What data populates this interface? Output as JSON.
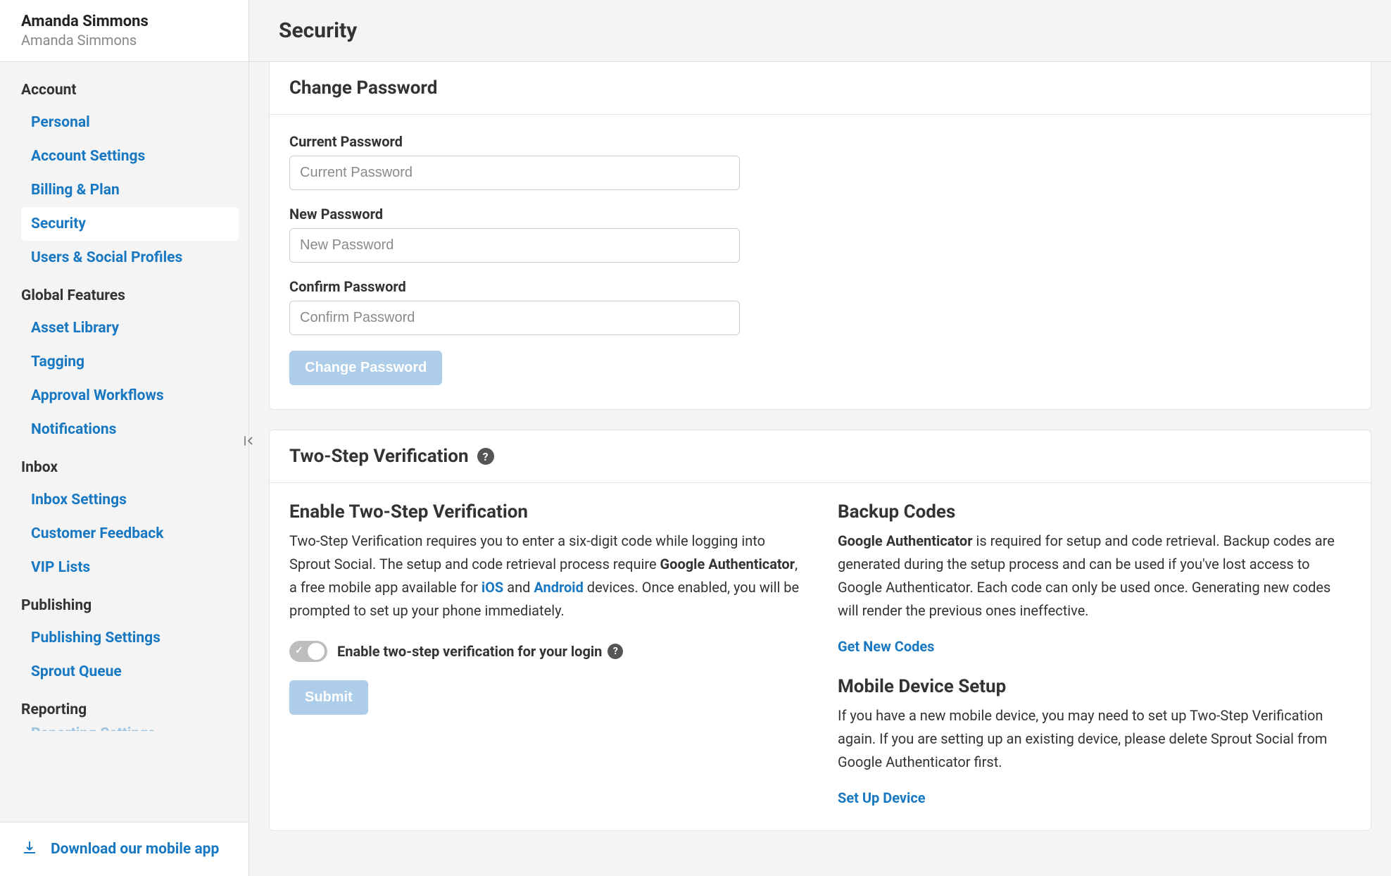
{
  "user": {
    "name": "Amanda Simmons",
    "subname": "Amanda Simmons"
  },
  "sidebar": {
    "sections": [
      {
        "title": "Account",
        "items": [
          {
            "label": "Personal",
            "active": false
          },
          {
            "label": "Account Settings",
            "active": false
          },
          {
            "label": "Billing & Plan",
            "active": false
          },
          {
            "label": "Security",
            "active": true
          },
          {
            "label": "Users & Social Profiles",
            "active": false
          }
        ]
      },
      {
        "title": "Global Features",
        "items": [
          {
            "label": "Asset Library",
            "active": false
          },
          {
            "label": "Tagging",
            "active": false
          },
          {
            "label": "Approval Workflows",
            "active": false
          },
          {
            "label": "Notifications",
            "active": false
          }
        ]
      },
      {
        "title": "Inbox",
        "items": [
          {
            "label": "Inbox Settings",
            "active": false
          },
          {
            "label": "Customer Feedback",
            "active": false
          },
          {
            "label": "VIP Lists",
            "active": false
          }
        ]
      },
      {
        "title": "Publishing",
        "items": [
          {
            "label": "Publishing Settings",
            "active": false
          },
          {
            "label": "Sprout Queue",
            "active": false
          }
        ]
      },
      {
        "title": "Reporting",
        "items": [
          {
            "label": "Reporting Settings",
            "active": false
          }
        ]
      }
    ],
    "footer_label": "Download our mobile app"
  },
  "page": {
    "title": "Security"
  },
  "change_password": {
    "heading": "Change Password",
    "current_label": "Current Password",
    "current_placeholder": "Current Password",
    "new_label": "New Password",
    "new_placeholder": "New Password",
    "confirm_label": "Confirm Password",
    "confirm_placeholder": "Confirm Password",
    "button_label": "Change Password"
  },
  "two_step": {
    "heading": "Two-Step Verification",
    "enable_heading": "Enable Two-Step Verification",
    "enable_desc_1": "Two-Step Verification requires you to enter a six-digit code while logging into Sprout Social. The setup and code retrieval process require ",
    "enable_desc_bold": "Google Authenticator",
    "enable_desc_2": ", a free mobile app available for ",
    "enable_ios": "iOS",
    "enable_and": " and ",
    "enable_android": "Android",
    "enable_desc_3": " devices. Once enabled, you will be prompted to set up your phone immediately.",
    "toggle_label": "Enable two-step verification for your login",
    "submit_label": "Submit",
    "backup_heading": "Backup Codes",
    "backup_bold": "Google Authenticator",
    "backup_desc": " is required for setup and code retrieval. Backup codes are generated during the setup process and can be used if you've lost access to Google Authenticator. Each code can only be used once. Generating new codes will render the previous ones ineffective.",
    "get_codes_label": "Get New Codes",
    "mobile_heading": "Mobile Device Setup",
    "mobile_desc": "If you have a new mobile device, you may need to set up Two-Step Verification again. If you are setting up an existing device, please delete Sprout Social from Google Authenticator first.",
    "setup_device_label": "Set Up Device"
  }
}
